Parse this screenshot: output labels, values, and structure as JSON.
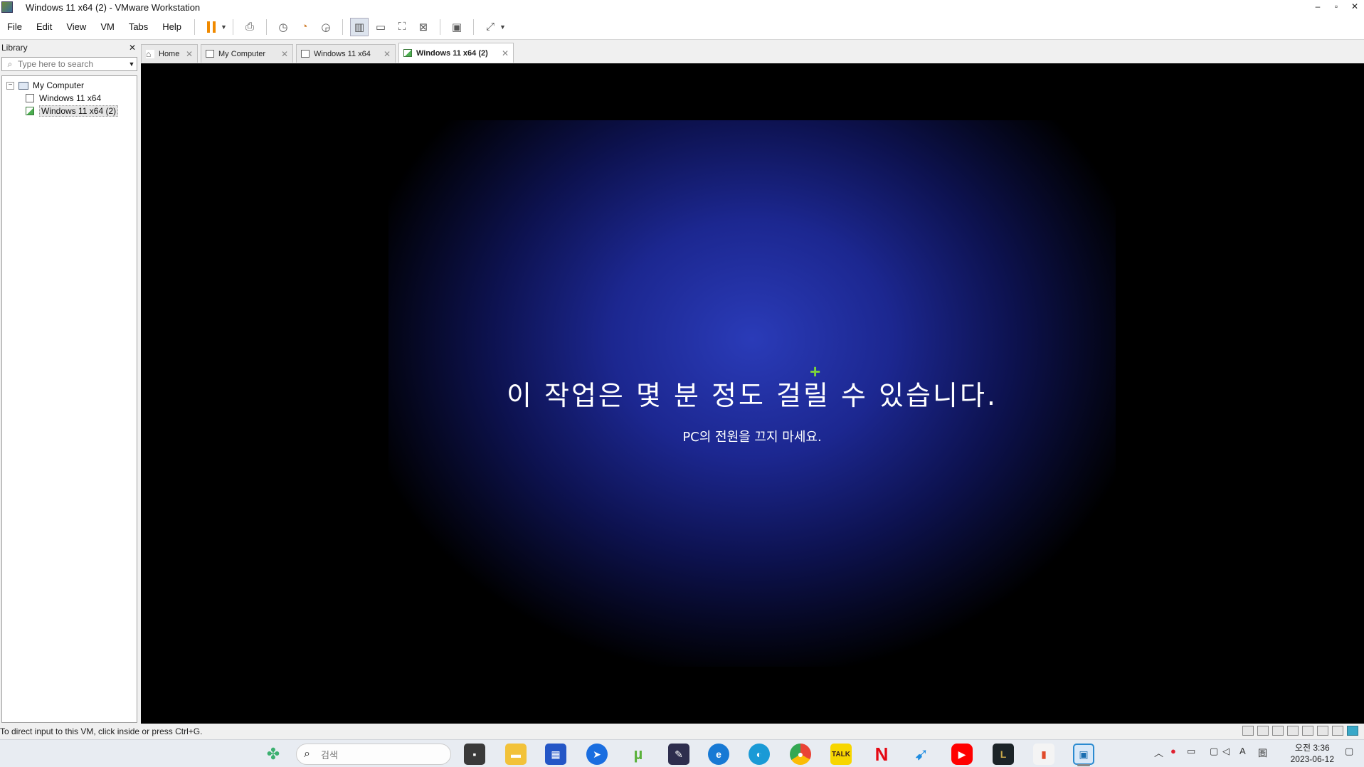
{
  "window": {
    "title": "Windows 11 x64 (2) - VMware Workstation"
  },
  "menu": [
    "File",
    "Edit",
    "View",
    "VM",
    "Tabs",
    "Help"
  ],
  "library": {
    "title": "Library",
    "search_placeholder": "Type here to search",
    "tree": {
      "root": "My Computer",
      "items": [
        "Windows 11 x64",
        "Windows 11 x64 (2)"
      ]
    }
  },
  "tabs": [
    {
      "label": "Home",
      "active": false
    },
    {
      "label": "My Computer",
      "active": false
    },
    {
      "label": "Windows 11 x64",
      "active": false
    },
    {
      "label": "Windows 11 x64 (2)",
      "active": true
    }
  ],
  "guest": {
    "main_text": "이 작업은 몇 분 정도 걸릴 수 있습니다.",
    "sub_text": "PC의 전원을 끄지 마세요."
  },
  "statusbar": {
    "hint": "To direct input to this VM, click inside or press Ctrl+G."
  },
  "taskbar": {
    "search_placeholder": "검색",
    "clock_time": "오전 3:36",
    "clock_date": "2023-06-12",
    "ime": "A",
    "ime2": "圄"
  },
  "colors": {
    "pause_accent": "#f08a00",
    "vm_bg_center": "#2a3bb8",
    "cursor_plus": "#7cd33a"
  }
}
